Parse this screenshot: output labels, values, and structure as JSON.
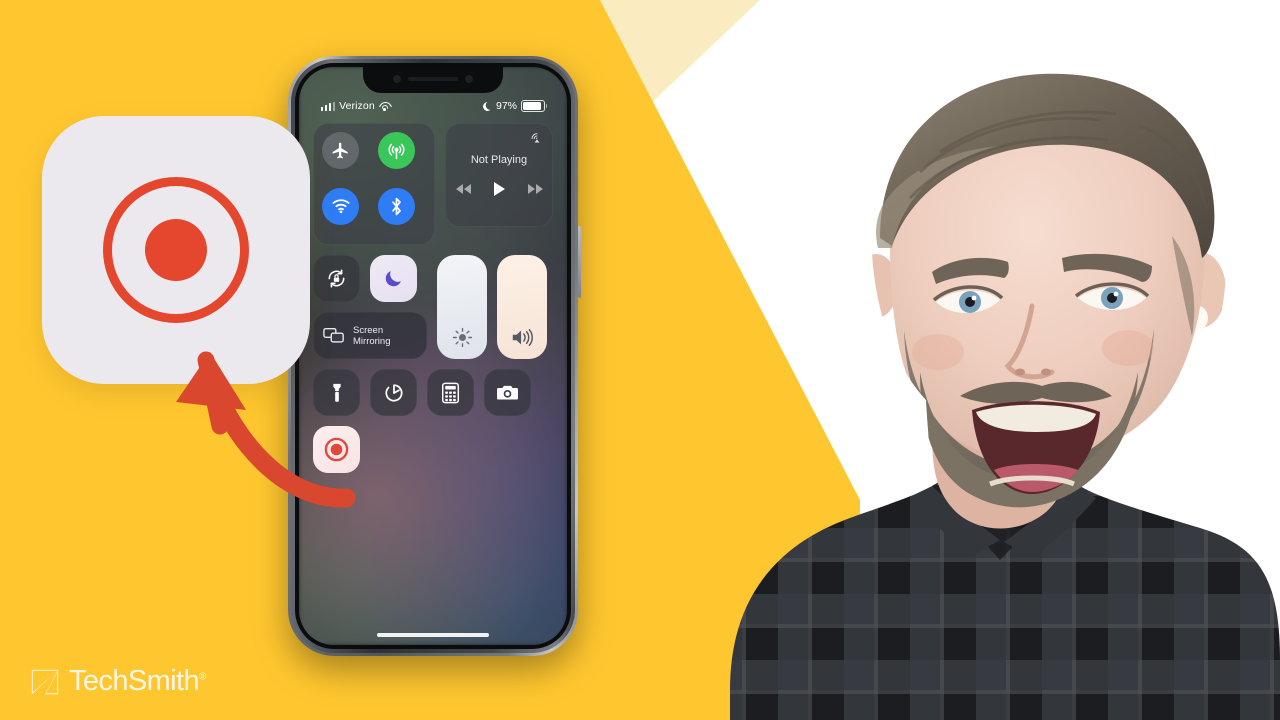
{
  "background": {
    "yellow": "#FFC72F",
    "cream": "#FBEBC0",
    "white": "#FFFFFF"
  },
  "phone": {
    "status_bar": {
      "carrier": "Verizon",
      "signal_icon": "cellular-signal-icon",
      "wifi_icon": "wifi-icon",
      "dnd_icon": "moon-icon",
      "battery_percent": "97%",
      "battery_icon": "battery-icon"
    },
    "control_center": {
      "connectivity": {
        "airplane_mode": {
          "icon": "airplane-icon",
          "state": "off"
        },
        "cellular_data": {
          "icon": "cellular-data-icon",
          "state": "on"
        },
        "wifi": {
          "icon": "wifi-icon",
          "state": "on"
        },
        "bluetooth": {
          "icon": "bluetooth-icon",
          "state": "on"
        }
      },
      "media": {
        "title": "Not Playing",
        "airplay_icon": "airplay-icon",
        "rewind_icon": "rewind-icon",
        "play_icon": "play-icon",
        "forward_icon": "fast-forward-icon"
      },
      "rotation_lock": {
        "icon": "rotation-lock-icon",
        "state": "off"
      },
      "do_not_disturb": {
        "icon": "moon-icon",
        "state": "on"
      },
      "screen_mirroring": {
        "label_line1": "Screen",
        "label_line2": "Mirroring",
        "icon": "screen-mirroring-icon"
      },
      "brightness": {
        "icon": "brightness-icon",
        "level": 100
      },
      "volume": {
        "icon": "volume-icon",
        "level": 100
      },
      "flashlight": {
        "icon": "flashlight-icon",
        "state": "off"
      },
      "timer": {
        "icon": "timer-icon",
        "state": "off"
      },
      "calculator": {
        "icon": "calculator-icon",
        "state": "off"
      },
      "camera": {
        "icon": "camera-icon",
        "state": "off"
      },
      "screen_recording": {
        "icon": "record-icon",
        "state": "on"
      }
    },
    "home_indicator": "home-indicator"
  },
  "callout": {
    "icon": "screen-record-icon",
    "accent_color": "#E4472D",
    "card_color": "#ECE9EE",
    "arrow": "curved-arrow-pointing-to-record-icon"
  },
  "logo": {
    "name": "TechSmith",
    "trademark": "®",
    "mark": "techsmith-bowtie-logo"
  },
  "person": {
    "description": "smiling-presenter"
  }
}
